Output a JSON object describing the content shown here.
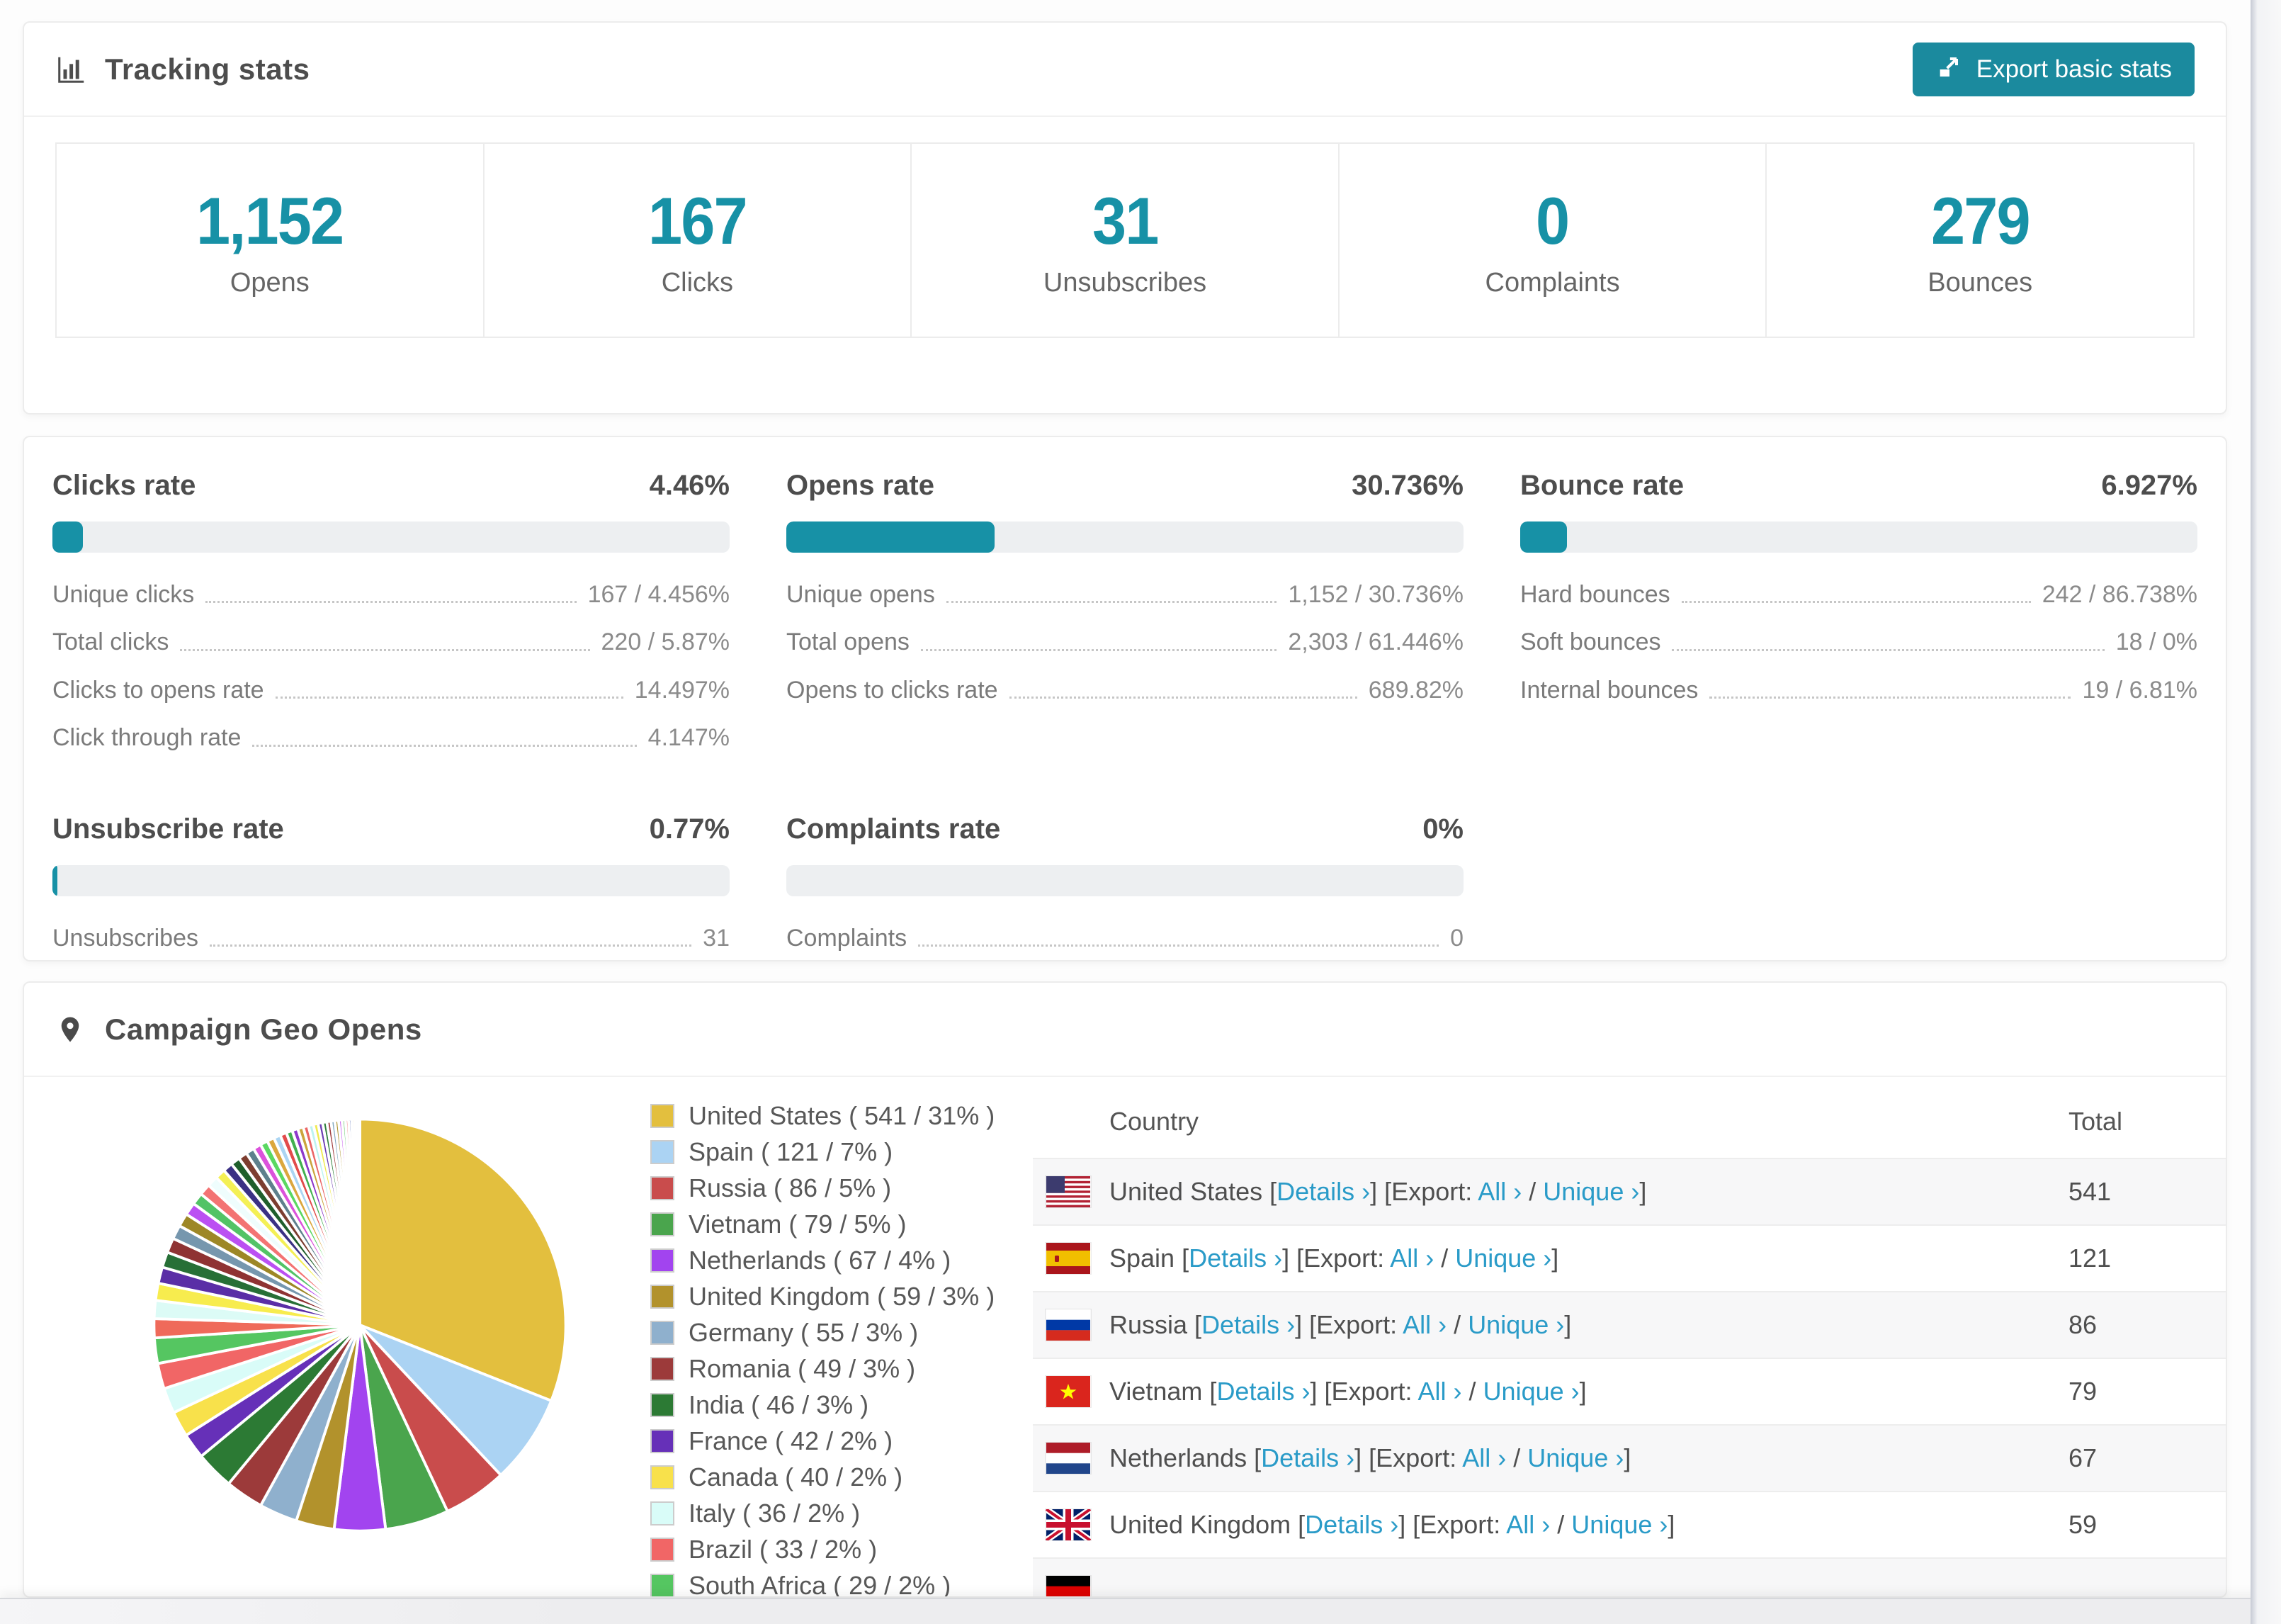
{
  "colors": {
    "accent": "#1b8a9e",
    "stat_number": "#1791a6",
    "bar_fill": "#1791a6",
    "bar_track": "#edeff1",
    "link": "#2a9bc8"
  },
  "tracking": {
    "title": "Tracking stats",
    "export_button": "Export basic stats",
    "stats": [
      {
        "value": "1,152",
        "label": "Opens"
      },
      {
        "value": "167",
        "label": "Clicks"
      },
      {
        "value": "31",
        "label": "Unsubscribes"
      },
      {
        "value": "0",
        "label": "Complaints"
      },
      {
        "value": "279",
        "label": "Bounces"
      }
    ]
  },
  "rate_blocks": [
    {
      "id": "clicks-rate",
      "title": "Clicks rate",
      "value": "4.46%",
      "bar_pct": 4.46,
      "rows": [
        {
          "label": "Unique clicks",
          "value": "167 / 4.456%"
        },
        {
          "label": "Total clicks",
          "value": "220 / 5.87%"
        },
        {
          "label": "Clicks to opens rate",
          "value": "14.497%"
        },
        {
          "label": "Click through rate",
          "value": "4.147%"
        }
      ]
    },
    {
      "id": "opens-rate",
      "title": "Opens rate",
      "value": "30.736%",
      "bar_pct": 30.736,
      "rows": [
        {
          "label": "Unique opens",
          "value": "1,152 / 30.736%"
        },
        {
          "label": "Total opens",
          "value": "2,303 / 61.446%"
        },
        {
          "label": "Opens to clicks rate",
          "value": "689.82%"
        }
      ]
    },
    {
      "id": "bounce-rate",
      "title": "Bounce rate",
      "value": "6.927%",
      "bar_pct": 6.927,
      "rows": [
        {
          "label": "Hard bounces",
          "value": "242 / 86.738%"
        },
        {
          "label": "Soft bounces",
          "value": "18 / 0%"
        },
        {
          "label": "Internal bounces",
          "value": "19 / 6.81%"
        }
      ]
    },
    {
      "id": "unsubscribe-rate",
      "title": "Unsubscribe rate",
      "value": "0.77%",
      "bar_pct": 0.77,
      "rows": [
        {
          "label": "Unsubscribes",
          "value": "31"
        }
      ]
    },
    {
      "id": "complaints-rate",
      "title": "Complaints rate",
      "value": "0%",
      "bar_pct": 0,
      "rows": [
        {
          "label": "Complaints",
          "value": "0"
        }
      ]
    }
  ],
  "geo": {
    "title": "Campaign Geo Opens",
    "chart_data": {
      "type": "pie",
      "title": "Campaign Geo Opens",
      "start_angle_deg": -90,
      "direction": "clockwise",
      "legend_position": "right",
      "series": [
        {
          "name": "United States",
          "count": 541,
          "pct": 31,
          "color": "#e3bf3e"
        },
        {
          "name": "Spain",
          "count": 121,
          "pct": 7,
          "color": "#abd3f3"
        },
        {
          "name": "Russia",
          "count": 86,
          "pct": 5,
          "color": "#c94c4c"
        },
        {
          "name": "Vietnam",
          "count": 79,
          "pct": 5,
          "color": "#4aa54d"
        },
        {
          "name": "Netherlands",
          "count": 67,
          "pct": 4,
          "color": "#a244ef"
        },
        {
          "name": "United Kingdom",
          "count": 59,
          "pct": 3,
          "color": "#b2922c"
        },
        {
          "name": "Germany",
          "count": 55,
          "pct": 3,
          "color": "#8fb0cd"
        },
        {
          "name": "Romania",
          "count": 49,
          "pct": 3,
          "color": "#9c3a3a"
        },
        {
          "name": "India",
          "count": 46,
          "pct": 3,
          "color": "#2c7a34"
        },
        {
          "name": "France",
          "count": 42,
          "pct": 2,
          "color": "#6630b8"
        },
        {
          "name": "Canada",
          "count": 40,
          "pct": 2,
          "color": "#f8e14b"
        },
        {
          "name": "Italy",
          "count": 36,
          "pct": 2,
          "color": "#d9fcf8"
        },
        {
          "name": "Brazil",
          "count": 33,
          "pct": 2,
          "color": "#f16666"
        },
        {
          "name": "South Africa",
          "count": 29,
          "pct": 2,
          "color": "#55c661"
        }
      ],
      "others": {
        "note": "long tail of unlabeled thin slices up to 12 o'clock",
        "total_pct_est": 26,
        "slice_count_est": 40,
        "decay_ratio": 0.95,
        "colors": [
          "#ef6a5a",
          "#dcfbf6",
          "#f7ec4e",
          "#5a2ea6",
          "#276f36",
          "#8f3333",
          "#7697ae",
          "#9d8726",
          "#bb50f2",
          "#52c366",
          "#f37373",
          "#effdfd",
          "#f4f055",
          "#3b3184",
          "#1f5f2c",
          "#7d3e30",
          "#5e808c",
          "#db52db",
          "#5bd861",
          "#dba73d",
          "#abd5f3",
          "#e24b4b",
          "#42b04f",
          "#8d39cb",
          "#cba43d",
          "#ea6666",
          "#bdf3f0",
          "#f0ea51",
          "#6d3eb3",
          "#31803d",
          "#a34343",
          "#86abc2",
          "#b09733",
          "#c963f1",
          "#68cb71",
          "#f48d8d",
          "#3a57a8",
          "#f2c14d",
          "#62d9d0",
          "#c24fd8"
        ]
      }
    },
    "legend_format": "{name} ( {count} / {pct}% )",
    "table": {
      "headers": [
        "Country",
        "Total"
      ],
      "labels": {
        "details": "Details ›",
        "export_prefix": "Export:",
        "all": "All ›",
        "unique": "Unique ›",
        "slash": "/"
      },
      "rows": [
        {
          "country": "United States",
          "flag": "us",
          "total": "541",
          "partial": false
        },
        {
          "country": "Spain",
          "flag": "es",
          "total": "121",
          "partial": false
        },
        {
          "country": "Russia",
          "flag": "ru",
          "total": "86",
          "partial": false
        },
        {
          "country": "Vietnam",
          "flag": "vn",
          "total": "79",
          "partial": false
        },
        {
          "country": "Netherlands",
          "flag": "nl",
          "total": "67",
          "partial": false
        },
        {
          "country": "United Kingdom",
          "flag": "gb",
          "total": "59",
          "partial": false
        },
        {
          "country": "",
          "flag": "de",
          "total": "",
          "partial": true
        }
      ]
    }
  }
}
